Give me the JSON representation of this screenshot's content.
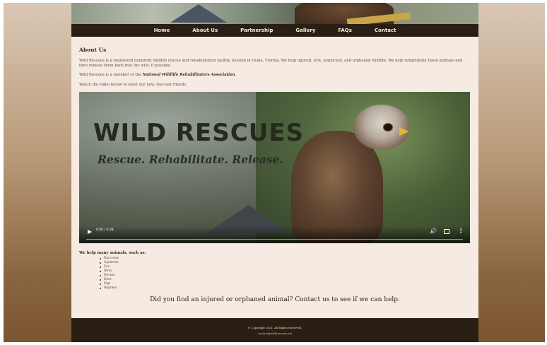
{
  "nav": {
    "items": [
      "Home",
      "About Us",
      "Partnership",
      "Gallery",
      "FAQs",
      "Contact"
    ]
  },
  "about": {
    "heading": "About Us",
    "p1": "Wild Rescues is a registered nonprofit wildlife rescue and rehabilitation facility, located in Ocala, Florida. We help injured, sick, neglected, and orphaned wildlife. We help rehabilitate these animals and then release them back into the wild, if possible.",
    "p2_prefix": "Wild Rescues is a member of the ",
    "p2_association": "National Wildlife Rehabilitators Association",
    "p2_suffix": ".",
    "p3": "Watch the video below to meet our new, rescued friends."
  },
  "video": {
    "title_text": "WILD RESCUES",
    "tagline": "Rescue. Rehabilitate. Release.",
    "time": "0:00 / 0:38",
    "progress": 0
  },
  "animals": {
    "label": "We help many animals, such as:",
    "items": [
      "Raccoons",
      "Squirrels",
      "Fox",
      "Birds",
      "Horses",
      "Deer",
      "Pigs",
      "Reptiles"
    ]
  },
  "cta": "Did you find an injured or orphaned animal? Contact us to see if we can help.",
  "footer": {
    "copyright": "© Copyright 2021. All Rights Reserved.",
    "email": "contact@wildrescues.net"
  },
  "colors": {
    "nav_bg": "#2a1f14",
    "page_bg": "#f5ebe2",
    "footer_bg": "#2a1f14",
    "email_link": "#e6c77a"
  }
}
